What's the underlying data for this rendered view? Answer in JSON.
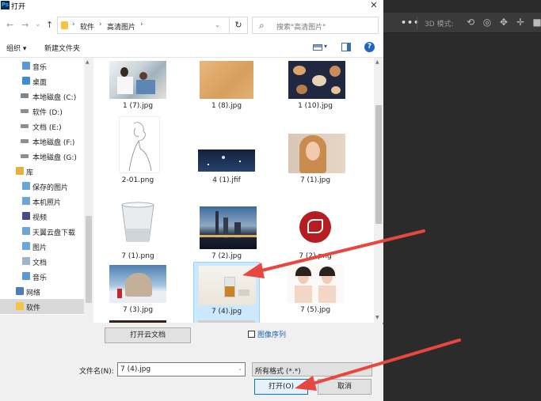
{
  "dialog": {
    "app_badge": "Ps",
    "title": "打开",
    "close": "✕"
  },
  "nav": {
    "back": "←",
    "forward": "→",
    "recent": "⌄",
    "up": "↑",
    "breadcrumb": [
      "软件",
      "高清图片"
    ],
    "refresh": "↻",
    "search_placeholder": "搜索\"高清图片\""
  },
  "toolbar": {
    "organize": "组织 ▾",
    "new_folder": "新建文件夹",
    "help": "?"
  },
  "sidebar": {
    "items": [
      {
        "label": "音乐",
        "icon": "music-icon"
      },
      {
        "label": "桌面",
        "icon": "desktop-icon"
      },
      {
        "label": "本地磁盘 (C:)",
        "icon": "drive-icon"
      },
      {
        "label": "软件 (D:)",
        "icon": "drive-icon"
      },
      {
        "label": "文档 (E:)",
        "icon": "drive-icon"
      },
      {
        "label": "本地磁盘 (F:)",
        "icon": "drive-icon"
      },
      {
        "label": "本地磁盘 (G:)",
        "icon": "drive-icon"
      },
      {
        "label": "库",
        "icon": "library-icon"
      },
      {
        "label": "保存的图片",
        "icon": "pictures-icon"
      },
      {
        "label": "本机照片",
        "icon": "pictures-icon"
      },
      {
        "label": "视频",
        "icon": "video-icon"
      },
      {
        "label": "天翼云盘下载",
        "icon": "download-icon"
      },
      {
        "label": "图片",
        "icon": "pictures-icon"
      },
      {
        "label": "文档",
        "icon": "documents-icon"
      },
      {
        "label": "音乐",
        "icon": "music-icon"
      },
      {
        "label": "网络",
        "icon": "network-icon"
      },
      {
        "label": "软件",
        "icon": "folder-icon"
      }
    ]
  },
  "files": [
    {
      "name": "1 (7).jpg"
    },
    {
      "name": "1 (8).jpg"
    },
    {
      "name": "1 (10).jpg"
    },
    {
      "name": "2-01.png"
    },
    {
      "name": "4 (1).jfif"
    },
    {
      "name": "7 (1).jpg"
    },
    {
      "name": "7 (1).png"
    },
    {
      "name": "7 (2).jpg"
    },
    {
      "name": "7 (2).png"
    },
    {
      "name": "7 (3).jpg"
    },
    {
      "name": "7 (4).jpg"
    },
    {
      "name": "7 (5).jpg"
    }
  ],
  "bottom": {
    "cloud_docs": "打开云文档",
    "image_sequence": "图像序列",
    "filename_label": "文件名(N):",
    "filename_value": "7 (4).jpg",
    "filetype_value": "所有格式 (*.*)",
    "open": "打开(O)",
    "cancel": "取消"
  },
  "photoshop": {
    "more": "•••",
    "mode_3d": "3D 模式:"
  },
  "colors": {
    "annotation_arrow": "#e8473f",
    "selection": "#cce8ff"
  }
}
